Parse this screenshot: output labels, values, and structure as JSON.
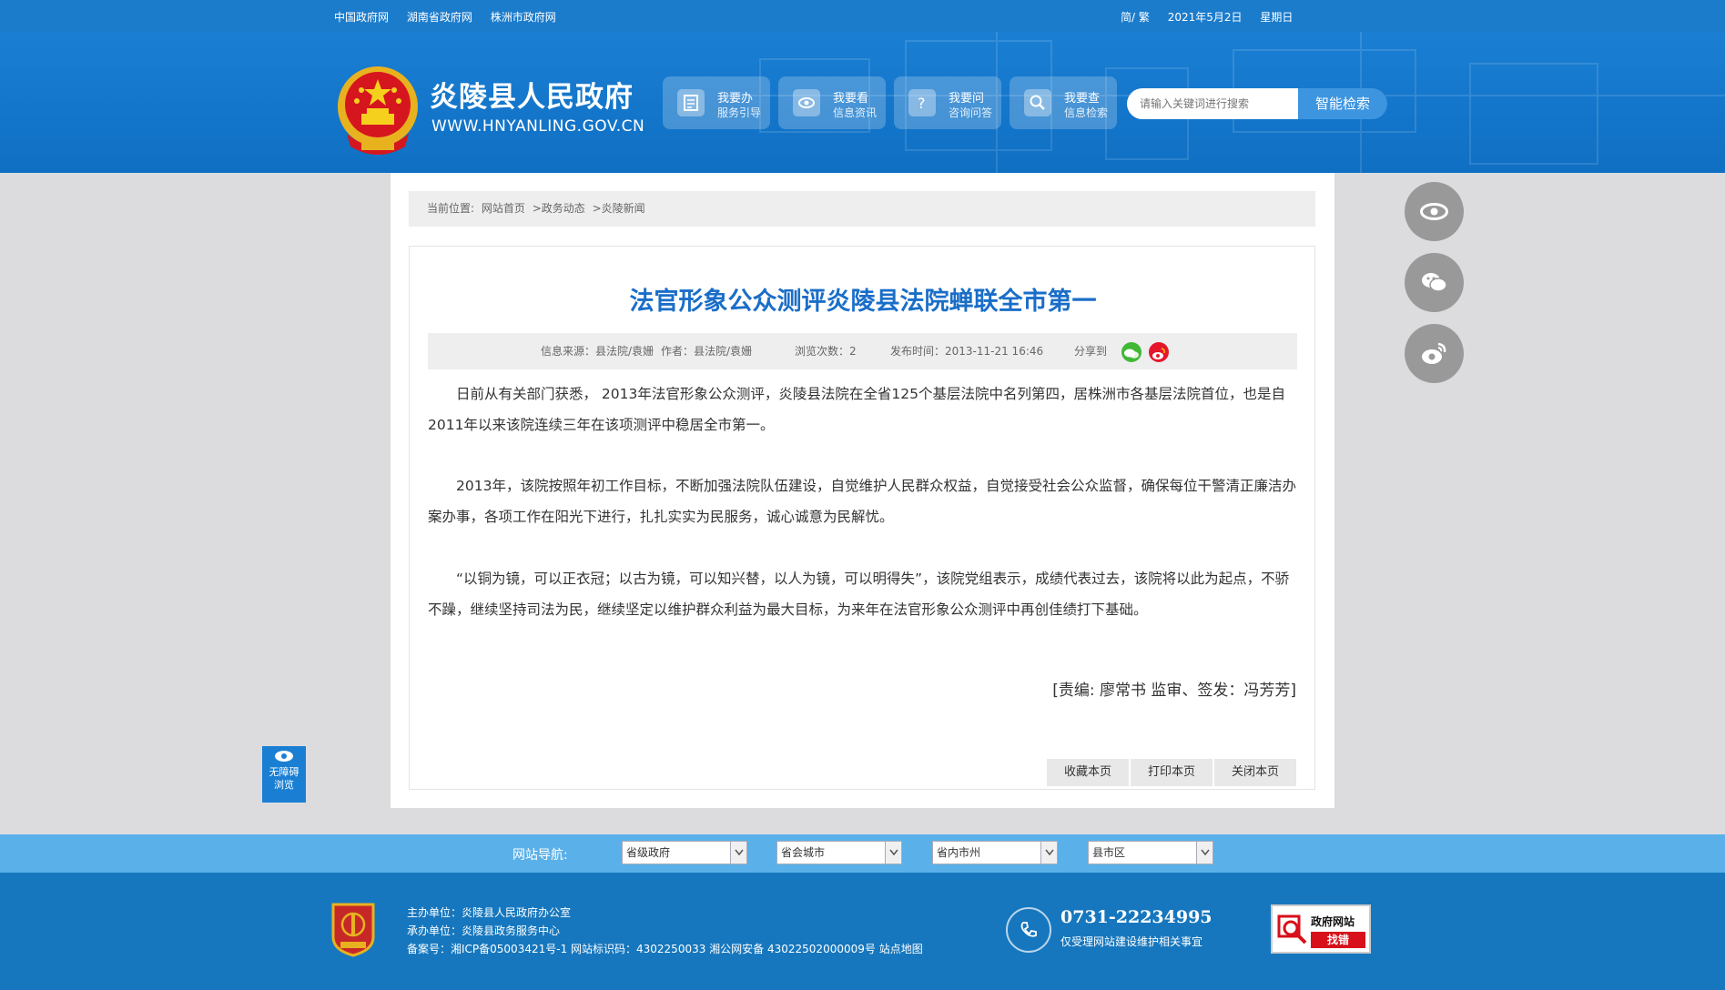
{
  "topbar": {
    "links": [
      "中国政府网",
      "湖南省政府网",
      "株洲市政府网"
    ],
    "lang": "简/ 繁",
    "date": "2021年5月2日",
    "weekday": "星期日"
  },
  "header": {
    "site_name": "炎陵县人民政府",
    "domain": "WWW.HNYANLING.GOV.CN",
    "quick": [
      {
        "title": "我要办",
        "sub": "服务引导",
        "icon": "document-icon"
      },
      {
        "title": "我要看",
        "sub": "信息资讯",
        "icon": "eye-icon"
      },
      {
        "title": "我要问",
        "sub": "咨询问答",
        "icon": "question-icon"
      },
      {
        "title": "我要查",
        "sub": "信息检索",
        "icon": "search-icon"
      }
    ],
    "search_placeholder": "请输入关键词进行搜索",
    "search_button": "智能检索"
  },
  "breadcrumb": {
    "prefix": "当前位置:",
    "items": [
      "网站首页",
      ">政务动态",
      ">炎陵新闻"
    ]
  },
  "article": {
    "title": "法官形象公众测评炎陵县法院蝉联全市第一",
    "meta": {
      "source": "信息来源：县法院/袁姗",
      "author": "作者：县法院/袁姗",
      "views": "浏览次数：2",
      "published": "发布时间：2013-11-21 16:46",
      "share": "分享到"
    },
    "paragraphs": [
      "日前从有关部门获悉， 2013年法官形象公众测评，炎陵县法院在全省125个基层法院中名列第四，居株洲市各基层法院首位，也是自2011年以来该院连续三年在该项测评中稳居全市第一。",
      "2013年，该院按照年初工作目标，不断加强法院队伍建设，自觉维护人民群众权益，自觉接受社会公众监督，确保每位干警清正廉洁办案办事，各项工作在阳光下进行，扎扎实实为民服务，诚心诚意为民解忧。",
      "“以铜为镜，可以正衣冠；以古为镜，可以知兴替，以人为镜，可以明得失”，该院党组表示，成绩代表过去，该院将以此为起点，不骄不躁，继续坚持司法为民，继续坚定以维护群众利益为最大目标，为来年在法官形象公众测评中再创佳绩打下基础。"
    ],
    "editor": "[责编: 廖常书  监审、签发：冯芳芳]",
    "actions": [
      "收藏本页",
      "打印本页",
      "关闭本页"
    ]
  },
  "side": {
    "accessibility": [
      "无障碍",
      "浏览"
    ]
  },
  "navbar": {
    "label": "网站导航:",
    "selects": [
      "省级政府",
      "省会城市",
      "省内市州",
      "县市区"
    ]
  },
  "footer": {
    "host": "主办单位：炎陵县人民政府办公室",
    "operator": "承办单位：炎陵县政务服务中心",
    "record": "备案号：湘ICP备05003421号-1 网站标识码：4302250033 湘公网安备 43022502000009号 站点地图",
    "phone": "0731-22234995",
    "phone_note": "仅受理网站建设维护相关事宜",
    "error_title": "政府网站",
    "error_action": "找错"
  },
  "colors": {
    "topbar": "#1c7ccc",
    "header": "#1474c6",
    "title": "#1a6ec8",
    "navbar": "#5ab0e8",
    "footer": "#1677be"
  }
}
